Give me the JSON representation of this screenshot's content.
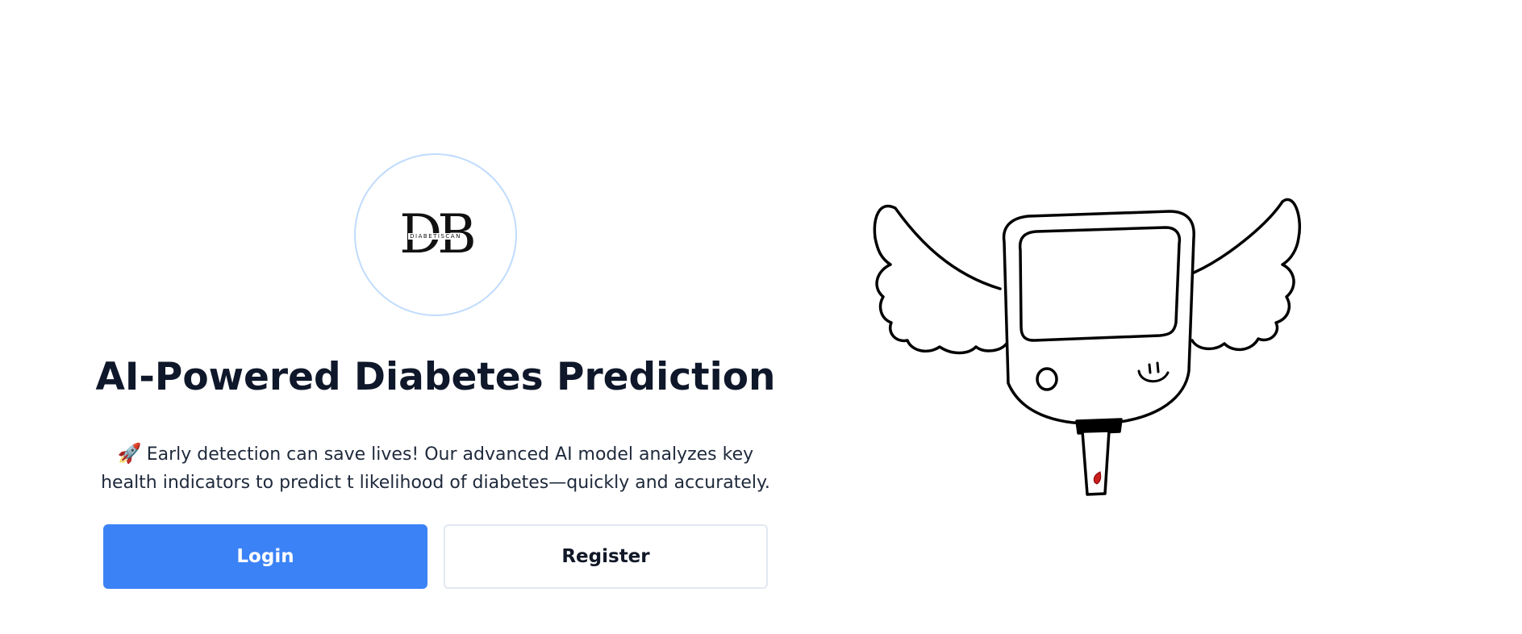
{
  "logo": {
    "letters": "DB",
    "subtitle": "DIABETISCAN",
    "accent_color": "#bfdbfe"
  },
  "hero": {
    "title": "AI-Powered Diabetes Prediction",
    "rocket_icon": "🚀",
    "description": "Early detection can save lives! Our advanced AI model analyzes key health indicators to predict t likelihood of diabetes—quickly and accurately."
  },
  "actions": {
    "login_label": "Login",
    "register_label": "Register",
    "primary_color": "#3b82f6"
  },
  "illustration": {
    "icon": "winged-glucose-meter-icon"
  }
}
